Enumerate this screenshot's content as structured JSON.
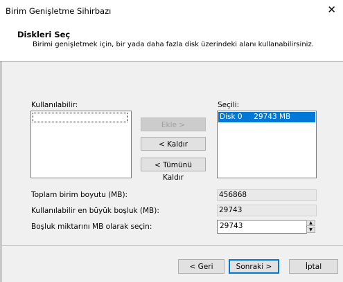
{
  "window": {
    "title": "Birim Genişletme Sihirbazı",
    "close_glyph": "✕"
  },
  "header": {
    "title": "Diskleri Seç",
    "subtitle": "Birimi genişletmek için, bir yada daha fazla disk üzerindeki alanı kullanabilirsiniz."
  },
  "available": {
    "label": "Kullanılabilir:",
    "items": []
  },
  "selected": {
    "label": "Seçili:",
    "items": [
      {
        "disk": "Disk 0",
        "size": "29743 MB",
        "text": "Disk 0     29743 MB"
      }
    ]
  },
  "buttons": {
    "add": "Ekle >",
    "remove": "< Kaldır",
    "remove_all": "< Tümünü Kaldır"
  },
  "fields": {
    "total_label": "Toplam birim boyutu (MB):",
    "total_value": "456868",
    "max_label": "Kullanılabilir en büyük boşluk (MB):",
    "max_value": "29743",
    "amount_label": "Boşluk miktarını MB olarak seçin:",
    "amount_value": "29743"
  },
  "footer": {
    "back": "< Geri",
    "next": "Sonraki >",
    "cancel": "İptal"
  }
}
